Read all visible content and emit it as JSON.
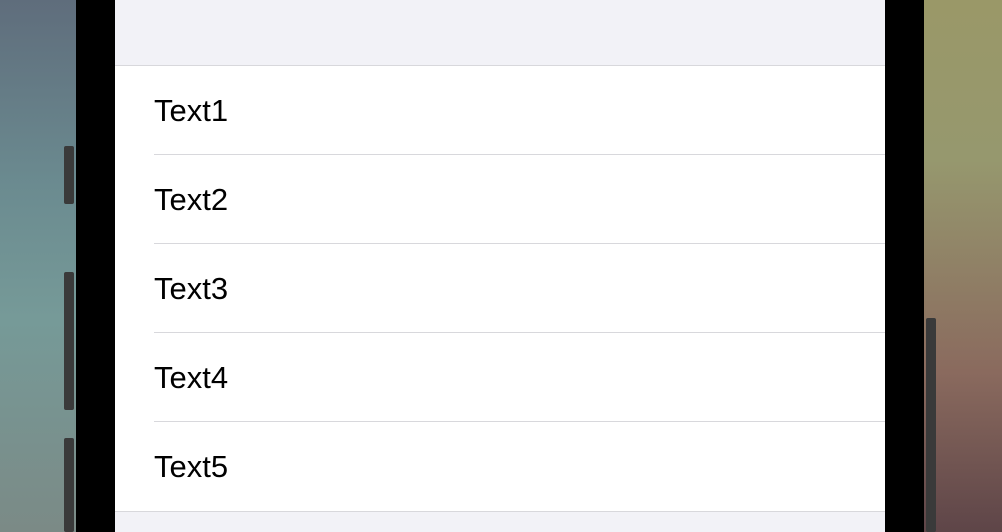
{
  "list": {
    "items": [
      {
        "label": "Text1"
      },
      {
        "label": "Text2"
      },
      {
        "label": "Text3"
      },
      {
        "label": "Text4"
      },
      {
        "label": "Text5"
      }
    ]
  },
  "colors": {
    "screen_background": "#f2f2f7",
    "cell_background": "#ffffff",
    "separator": "#d8d8dc",
    "text": "#000000",
    "device_bezel": "#000000"
  }
}
